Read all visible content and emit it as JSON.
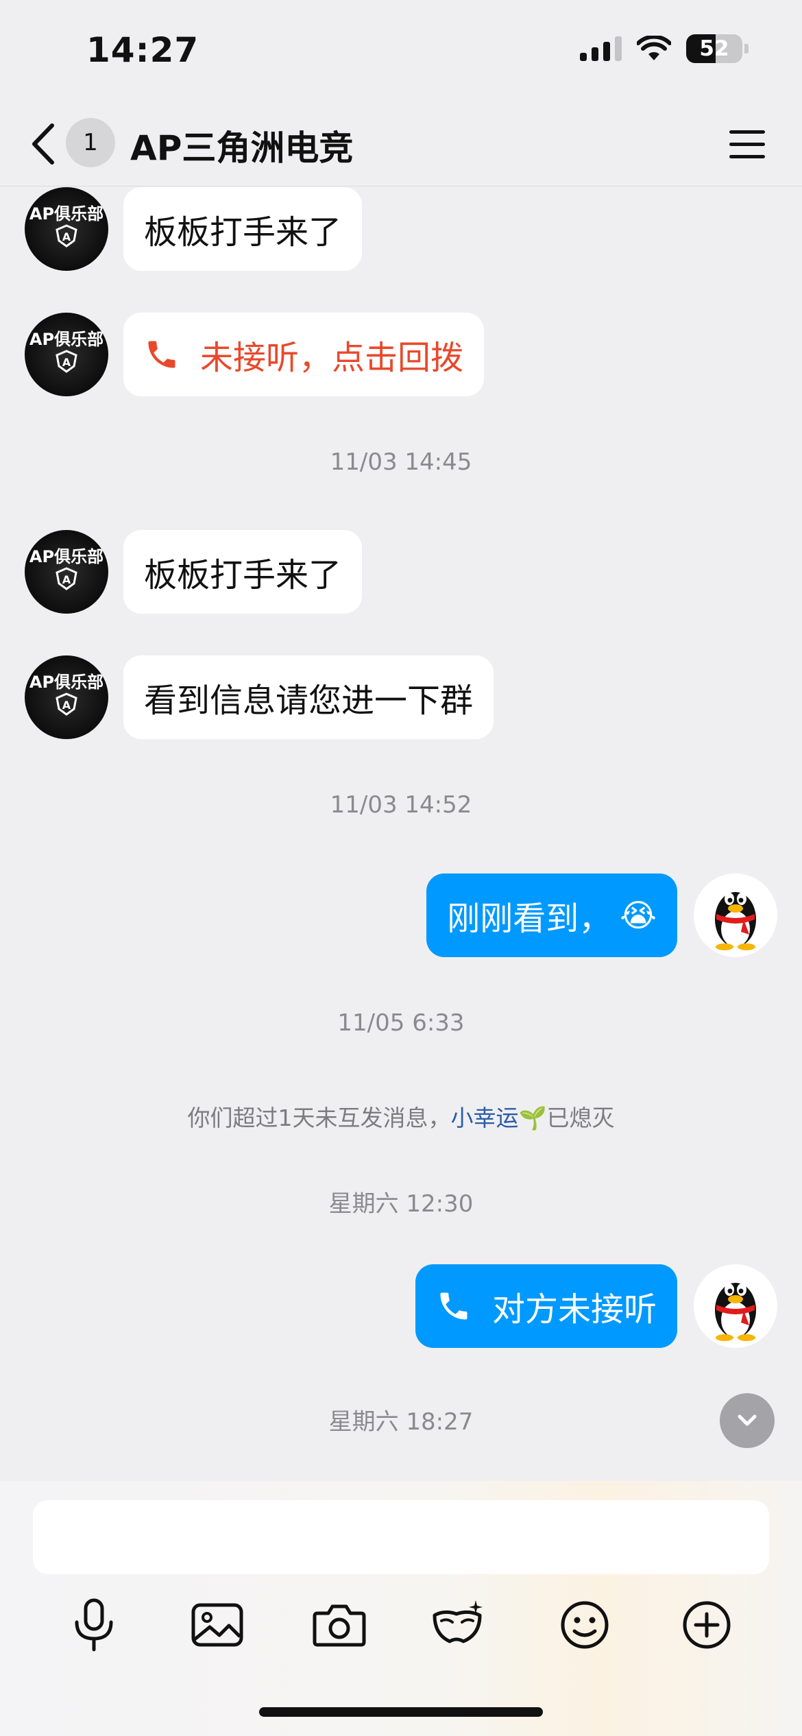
{
  "status": {
    "time": "14:27",
    "battery": "52"
  },
  "header": {
    "unread_badge": "1",
    "title": "AP三角洲电竞"
  },
  "messages": {
    "m1": {
      "text": "板板打手来了",
      "avatar_label": "AP俱乐部"
    },
    "m2": {
      "text": "未接听，点击回拨",
      "avatar_label": "AP俱乐部"
    },
    "ts1": "11/03 14:45",
    "m3": {
      "text": "板板打手来了",
      "avatar_label": "AP俱乐部"
    },
    "m4": {
      "text": "看到信息请您进一下群",
      "avatar_label": "AP俱乐部"
    },
    "ts2": "11/03 14:52",
    "m5": {
      "text": "刚刚看到，",
      "emoji": "😭"
    },
    "ts3": "11/05 6:33",
    "sys": {
      "prefix": "你们超过1天未互发消息，",
      "link": "小幸运",
      "icon": "🌱",
      "suffix": "已熄灭"
    },
    "ts4": "星期六 12:30",
    "m6": {
      "text": "对方未接听"
    },
    "ts5": "星期六 18:27"
  },
  "icons": [
    "back-icon",
    "menu-icon",
    "phone-icon",
    "penguin-icon",
    "chevron-down-icon",
    "mic-icon",
    "image-icon",
    "camera-icon",
    "mask-icon",
    "emoji-icon",
    "plus-icon"
  ],
  "colors": {
    "accent_blue": "#0099ff",
    "missed_red": "#e8492c",
    "link_blue": "#2c5ba8"
  }
}
